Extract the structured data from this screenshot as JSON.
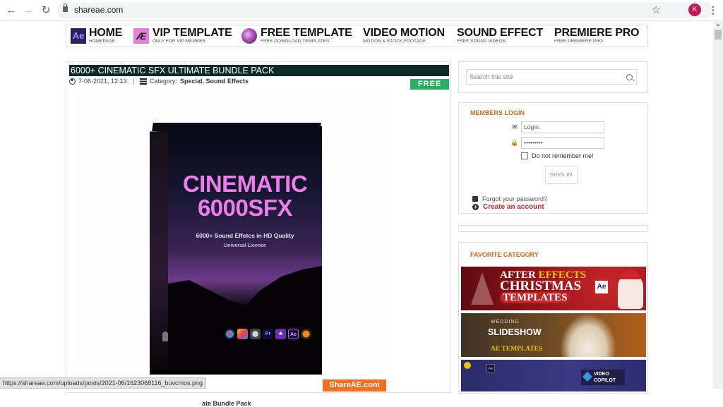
{
  "browser": {
    "url": "shareae.com",
    "profile_initial": "K",
    "profile_color": "#c2185b"
  },
  "topnav": {
    "items": [
      {
        "title": "HOME",
        "subtitle": "HOMEPAGE",
        "icon": "ae-icon",
        "icon_text": "Ae"
      },
      {
        "title": "VIP TEMPLATE",
        "subtitle": "ONLY FOR VIP MEMBER",
        "icon": "vip-ae-icon",
        "icon_text": "Æ"
      },
      {
        "title": "FREE TEMPLATE",
        "subtitle": "FREE DOWNLOAD TEMPLATES",
        "icon": "free-orb-icon",
        "icon_text": ""
      },
      {
        "title": "VIDEO MOTION",
        "subtitle": "MOTION & STOCK FOOTAGE"
      },
      {
        "title": "SOUND EFFECT",
        "subtitle": "FREE SOUND VIDEOS"
      },
      {
        "title": "PREMIERE PRO",
        "subtitle": "FREE PREMIERE PRO"
      }
    ]
  },
  "article": {
    "title": "6000+ CINEMATIC SFX ULTIMATE BUNDLE PACK",
    "date": "7-06-2021, 12:13",
    "separator": "|",
    "category_label": "Category:",
    "categories": "Special, Sound Effects",
    "badge": "FREE",
    "badge_color": "#27ae60",
    "image": {
      "title_line1": "CINEMATIC",
      "title_line2": "6000SFX",
      "subtitle": "6000+ Sound Effetcs in HD Quality",
      "subtitle2": "Universal Licence",
      "app_icons": [
        "davinci-resolve",
        "final-cut-pro",
        "motion",
        "Pr",
        "imovie",
        "Ae",
        "fl-studio"
      ],
      "watermark": "ShareAE.com"
    },
    "caption": "ate Bundle Pack"
  },
  "sidebar": {
    "search_placeholder": "Search this site",
    "login": {
      "heading": "MEMBERS LOGIN",
      "login_placeholder": "Login:",
      "password_value": "•••••••••",
      "remember_label": "Do not remember me!",
      "remember_checked": false,
      "signin_label": "SIGN IN",
      "forgot_label": "Forgot your password?",
      "create_label": "Create an account"
    },
    "favorite": {
      "heading": "FAVORITE CATEGORY",
      "banners": [
        {
          "line1a": "AFTER ",
          "line1b": "EFFECTS",
          "line2": "CHRISTMAS",
          "line3": "TEMPLATES",
          "badge": "Ae"
        },
        {
          "small": "WEDDING",
          "main": "SLIDESHOW",
          "sub": "AE TEMPLATES"
        },
        {
          "badge": "Ae",
          "logo": "VIDEO COPILOT"
        }
      ]
    }
  },
  "statusbar": {
    "text": "https://shareae.com/uploads/posts/2021-06/1623068116_buvcmos.png"
  }
}
